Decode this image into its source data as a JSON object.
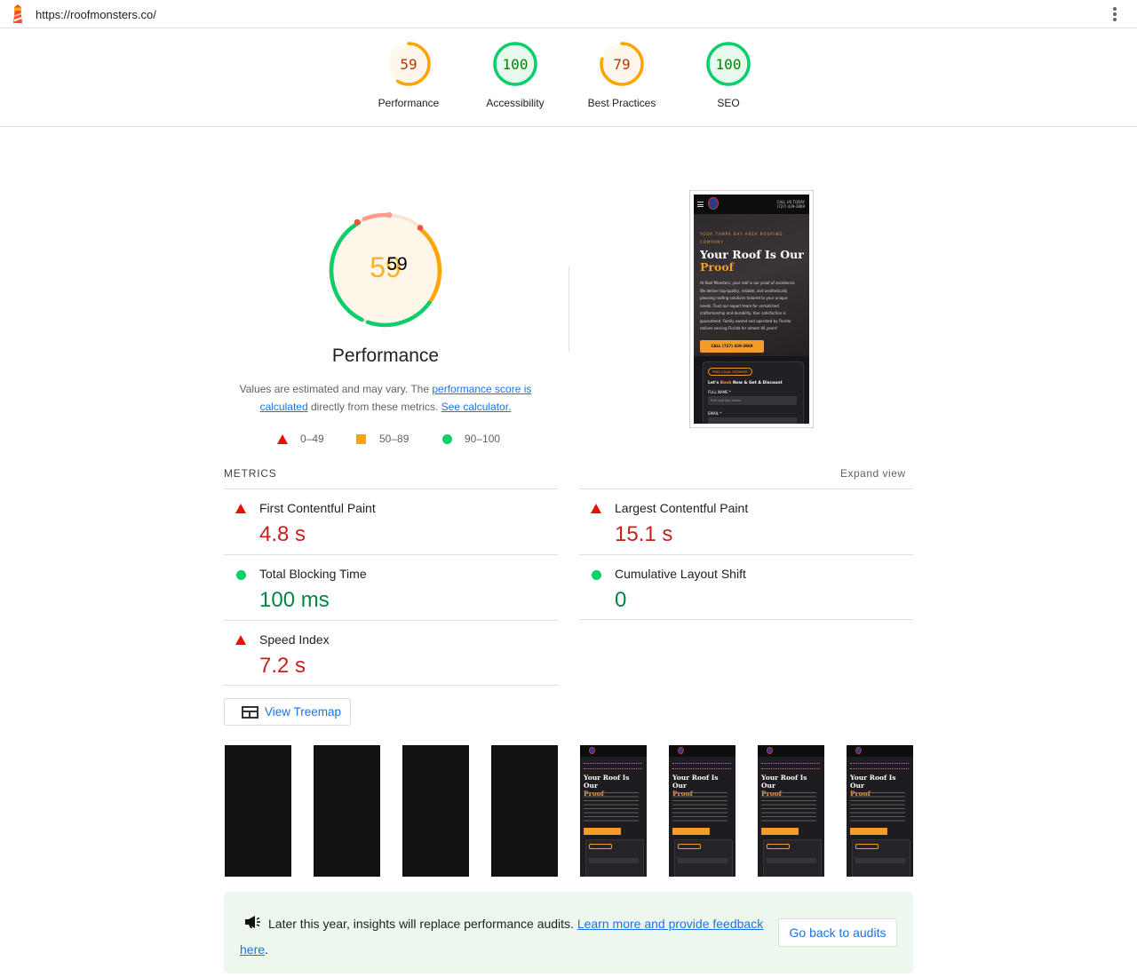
{
  "topbar": {
    "url": "https://roofmonsters.co/",
    "logo_icon": "lighthouse-icon",
    "menu_icon": "kebab-menu-icon"
  },
  "colors": {
    "fail": "#ff4e42",
    "average": "#ffa400",
    "pass": "#0cce6b",
    "link": "#1a73e8"
  },
  "scores": [
    {
      "label": "Performance",
      "value": "59",
      "score": 59,
      "rating": "average"
    },
    {
      "label": "Accessibility",
      "value": "100",
      "score": 100,
      "rating": "pass"
    },
    {
      "label": "Best Practices",
      "value": "79",
      "score": 79,
      "rating": "average"
    },
    {
      "label": "SEO",
      "value": "100",
      "score": 100,
      "rating": "pass"
    }
  ],
  "performance": {
    "score_text": "59",
    "title": "Performance",
    "desc_1": "Values are estimated and may vary. The ",
    "desc_link": "performance score is calculated",
    "desc_2": " directly from these metrics. ",
    "desc_link2": "See calculator.",
    "legend": [
      {
        "shape": "triangle",
        "label": "0–49"
      },
      {
        "shape": "square",
        "label": "50–89"
      },
      {
        "shape": "circle",
        "label": "90–100"
      }
    ]
  },
  "screenshot": {
    "phone_line1": "CALL US TODAY",
    "phone_line2": "(727) 439-3869",
    "kicker": "YOUR TAMPA BAY AREA ROOFING COMPANY",
    "h1_a": "Your Roof Is Our",
    "h1_b": "Proof",
    "para": "At Roof Monsters, your roof is our proof of excellence. We deliver top-quality, reliable, and aesthetically pleasing roofing solutions tailored to your unique needs. Trust our expert team for unmatched craftsmanship and durability. Your satisfaction is guaranteed. Family owned and operated by Florida natives serving Florida for almost 40 years!",
    "cta": "CALL (727) 439-3869",
    "badge": "FREE LOCAL ESTIMATE",
    "form_h_a": "Let's ",
    "form_h_acc": "Book",
    "form_h_b": " Now & Get A Discount",
    "label_name": "FULL NAME *",
    "ph_name": "First and last name",
    "label_email": "EMAIL *"
  },
  "metrics": {
    "heading": "METRICS",
    "expand": "Expand view",
    "items": [
      {
        "title": "First Contentful Paint",
        "value": "4.8 s",
        "rating": "fail"
      },
      {
        "title": "Largest Contentful Paint",
        "value": "15.1 s",
        "rating": "fail"
      },
      {
        "title": "Total Blocking Time",
        "value": "100 ms",
        "rating": "pass"
      },
      {
        "title": "Cumulative Layout Shift",
        "value": "0",
        "rating": "pass"
      },
      {
        "title": "Speed Index",
        "value": "7.2 s",
        "rating": "fail"
      }
    ]
  },
  "treemap": {
    "label": "View Treemap",
    "icon": "treemap-icon"
  },
  "filmstrip": {
    "frames": [
      "blank",
      "blank",
      "blank",
      "blank",
      "loaded",
      "loaded",
      "loaded",
      "loaded"
    ],
    "h1_a": "Your Roof Is Our",
    "h1_b": "Proof"
  },
  "banner": {
    "icon": "megaphone-icon",
    "text": "Later this year, insights will replace performance audits. ",
    "link": "Learn more and provide feedback here",
    "tail": ".",
    "button": "Go back to audits"
  }
}
